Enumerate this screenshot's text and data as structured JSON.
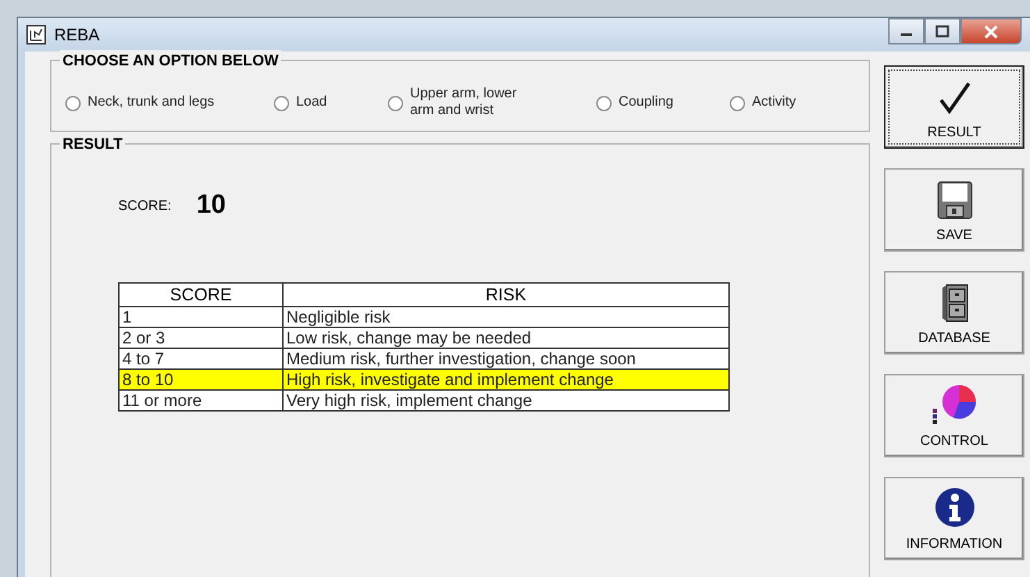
{
  "window": {
    "title": "REBA"
  },
  "options": {
    "title": "CHOOSE AN OPTION BELOW",
    "items": [
      {
        "label": "Neck, trunk and legs",
        "checked": false
      },
      {
        "label": "Load",
        "checked": false
      },
      {
        "label": "Upper arm, lower arm and wrist",
        "checked": false
      },
      {
        "label": "Coupling",
        "checked": false
      },
      {
        "label": "Activity",
        "checked": false
      }
    ]
  },
  "result": {
    "title": "RESULT",
    "score_label": "SCORE:",
    "score": "10",
    "table": {
      "columns": [
        "SCORE",
        "RISK"
      ],
      "rows": [
        {
          "cells": [
            "1",
            "Negligible risk"
          ],
          "highlighted": false
        },
        {
          "cells": [
            "2 or 3",
            "Low risk, change may be needed"
          ],
          "highlighted": false
        },
        {
          "cells": [
            "4 to 7",
            "Medium risk, further investigation, change soon"
          ],
          "highlighted": false
        },
        {
          "cells": [
            "8 to 10",
            "High risk, investigate and implement change"
          ],
          "highlighted": true
        },
        {
          "cells": [
            "11 or more",
            "Very high risk, implement change"
          ],
          "highlighted": false
        }
      ]
    }
  },
  "buttons": [
    {
      "label": "RESULT",
      "kind": "check",
      "focused": true
    },
    {
      "label": "SAVE",
      "kind": "disk",
      "focused": false
    },
    {
      "label": "DATABASE",
      "kind": "cabinet",
      "focused": false
    },
    {
      "label": "CONTROL",
      "kind": "chart",
      "focused": false
    },
    {
      "label": "INFORMATION",
      "kind": "info",
      "focused": false
    }
  ]
}
